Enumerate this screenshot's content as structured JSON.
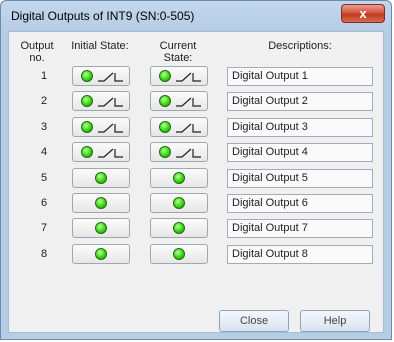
{
  "window": {
    "title": "Digital Outputs of INT9 (SN:0-505)",
    "close_glyph": "x"
  },
  "headers": {
    "output_no": [
      "Output",
      "no."
    ],
    "initial_state": "Initial State:",
    "current_state": [
      "Current",
      "State:"
    ],
    "descriptions": "Descriptions:"
  },
  "rows": [
    {
      "no": "1",
      "switch": true,
      "desc": "Digital Output 1"
    },
    {
      "no": "2",
      "switch": true,
      "desc": "Digital Output 2"
    },
    {
      "no": "3",
      "switch": true,
      "desc": "Digital Output 3"
    },
    {
      "no": "4",
      "switch": true,
      "desc": "Digital Output 4"
    },
    {
      "no": "5",
      "switch": false,
      "desc": "Digital Output 5"
    },
    {
      "no": "6",
      "switch": false,
      "desc": "Digital Output 6"
    },
    {
      "no": "7",
      "switch": false,
      "desc": "Digital Output 7"
    },
    {
      "no": "8",
      "switch": false,
      "desc": "Digital Output 8"
    }
  ],
  "buttons": {
    "close": "Close",
    "help": "Help"
  },
  "colors": {
    "led_on": "#37d40f",
    "title_bg": "#b6cde6",
    "close_red": "#c23a22"
  }
}
